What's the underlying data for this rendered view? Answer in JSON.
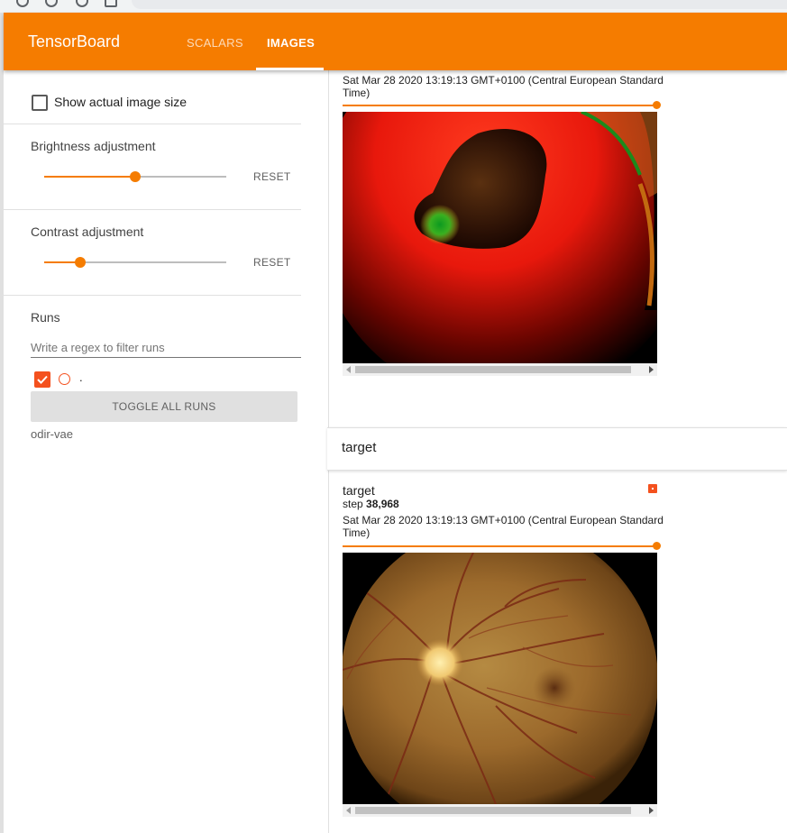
{
  "app": {
    "title": "TensorBoard",
    "tabs": [
      {
        "label": "SCALARS",
        "active": false
      },
      {
        "label": "IMAGES",
        "active": true
      }
    ],
    "accent_color": "#f57c00"
  },
  "sidebar": {
    "show_actual_size_label": "Show actual image size",
    "brightness": {
      "label": "Brightness adjustment",
      "reset_label": "RESET",
      "level": 0.5
    },
    "contrast": {
      "label": "Contrast adjustment",
      "reset_label": "RESET",
      "level": 0.2
    },
    "runs": {
      "heading": "Runs",
      "filter_placeholder": "Write a regex to filter runs",
      "items": [
        {
          "name": ".",
          "checked": true,
          "color": "#f4511e"
        }
      ],
      "toggle_all_label": "TOGGLE ALL RUNS",
      "footer": "odir-vae"
    }
  },
  "main": {
    "top_card": {
      "timestamp": "Sat Mar 28 2020 13:19:13 GMT+0100 (Central European Standard Time)",
      "step_level": 1.0
    },
    "group": {
      "title": "target"
    },
    "target_card": {
      "title": "target",
      "step_label": "step",
      "step_value": "38,968",
      "timestamp": "Sat Mar 28 2020 13:19:13 GMT+0100 (Central European Standard Time)",
      "step_level": 1.0
    }
  }
}
